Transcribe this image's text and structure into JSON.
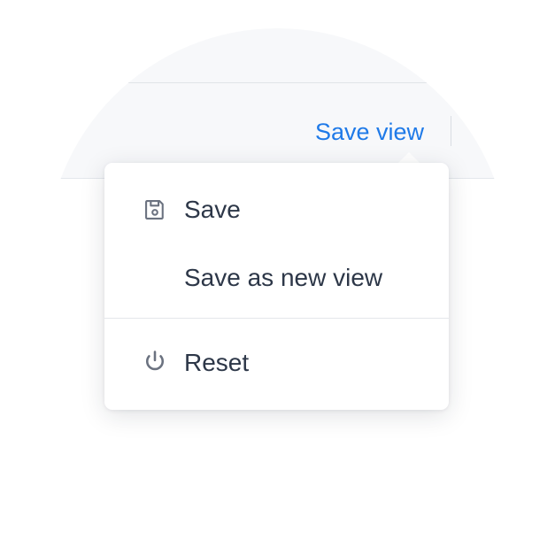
{
  "toolbar": {
    "save_view_label": "Save view"
  },
  "menu": {
    "items": [
      {
        "label": "Save",
        "icon": "save-icon"
      },
      {
        "label": "Save as new view",
        "icon": null
      },
      {
        "label": "Reset",
        "icon": "power-icon"
      }
    ]
  },
  "colors": {
    "link": "#1f7ae8",
    "text": "#2d3748",
    "icon": "#6b7280",
    "toolbar_bg": "#f7f8fa",
    "divider": "#e4e7eb"
  }
}
